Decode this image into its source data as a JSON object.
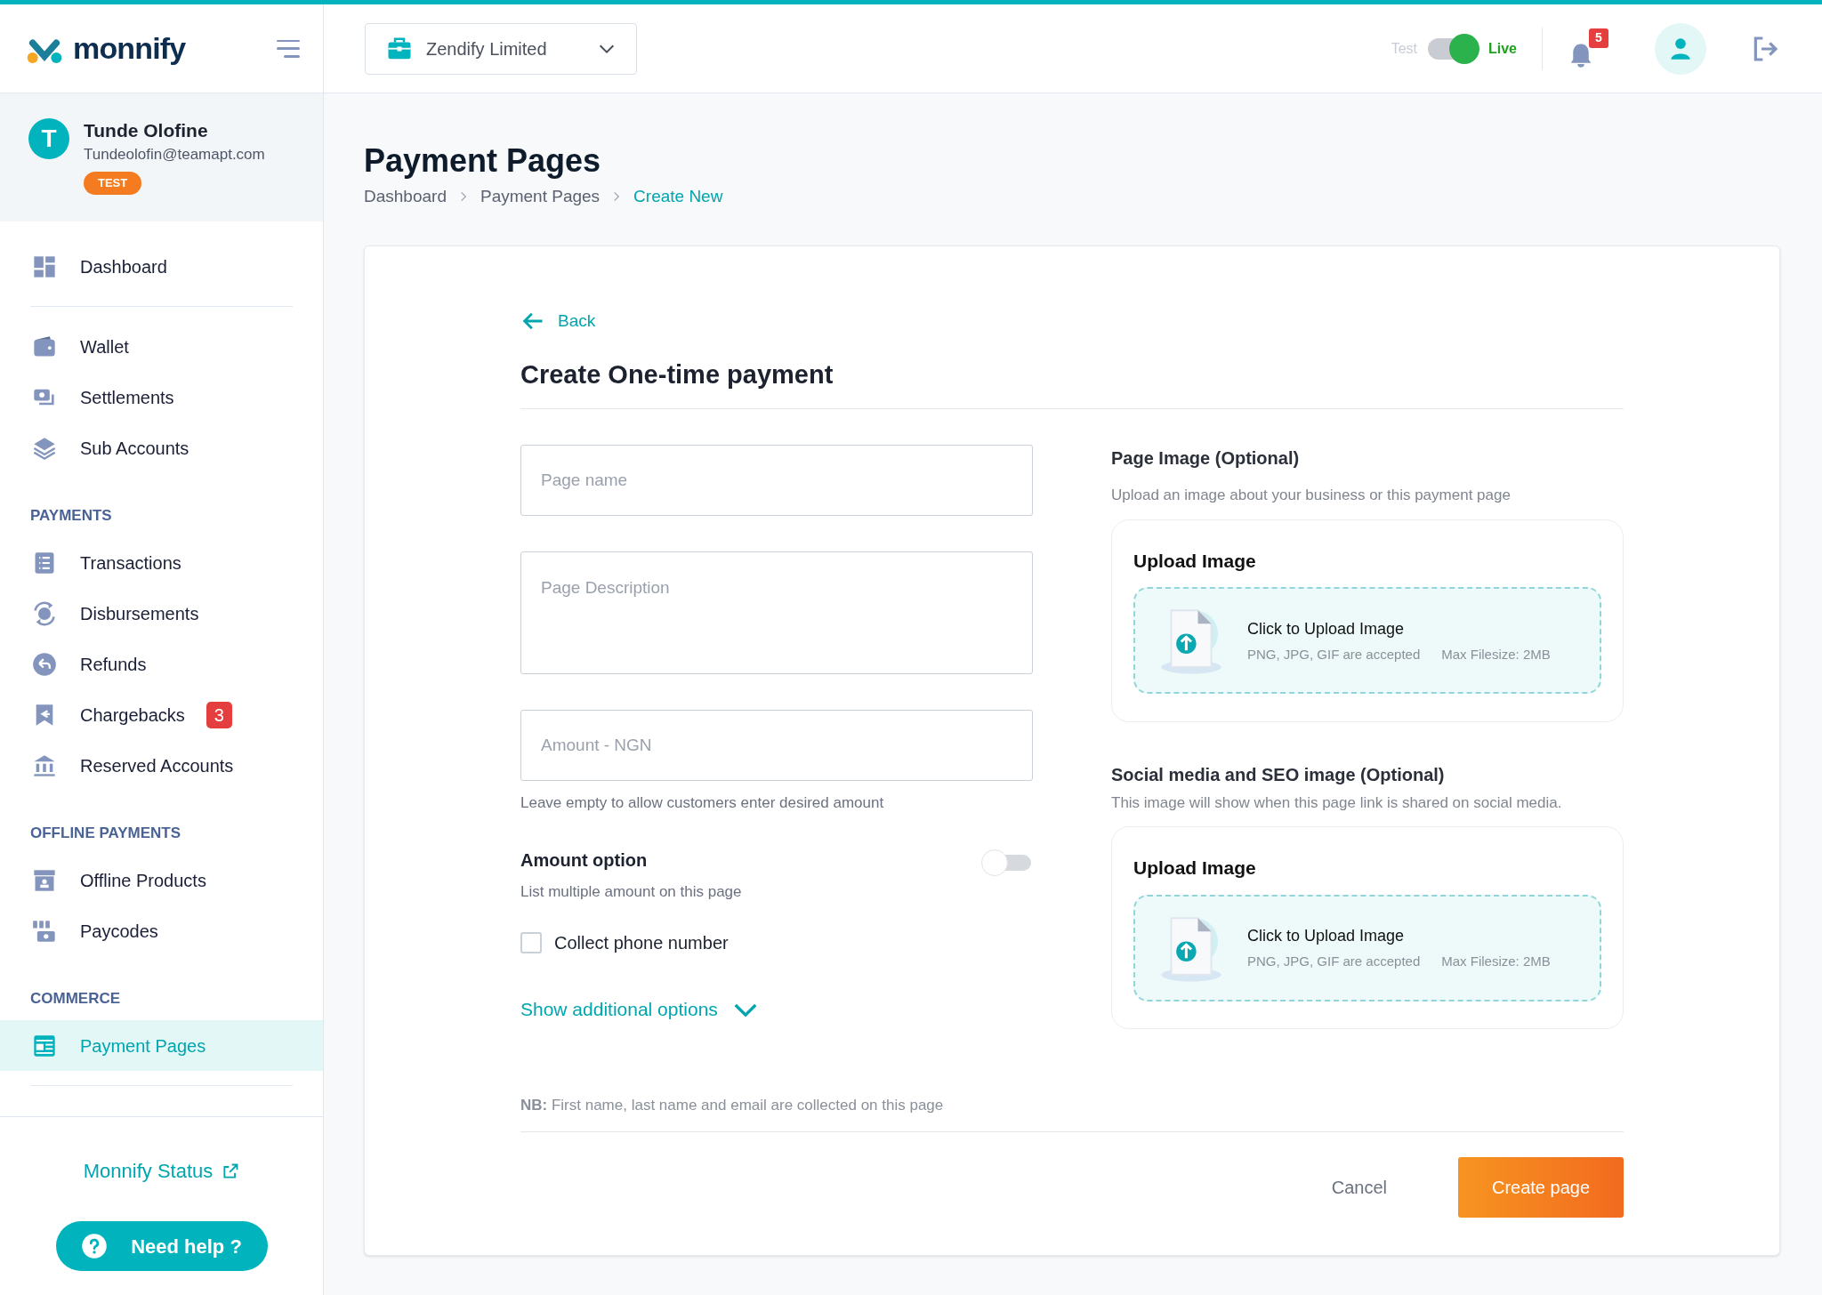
{
  "brand": {
    "name": "monnify"
  },
  "topbar": {
    "business": "Zendify Limited",
    "mode_toggle": {
      "off_label": "Test",
      "on_label": "Live",
      "on": true
    },
    "notification_count": "5"
  },
  "user": {
    "initial": "T",
    "name": "Tunde Olofine",
    "email": "Tundeolofin@teamapt.com",
    "badge": "TEST"
  },
  "sidebar": {
    "sections": [
      {
        "items": [
          {
            "label": "Dashboard",
            "selected": false
          }
        ]
      },
      {
        "items": [
          {
            "label": "Wallet",
            "selected": false
          },
          {
            "label": "Settlements",
            "selected": false
          },
          {
            "label": "Sub Accounts",
            "selected": false
          }
        ]
      },
      {
        "heading": "PAYMENTS",
        "items": [
          {
            "label": "Transactions",
            "selected": false
          },
          {
            "label": "Disbursements",
            "selected": false
          },
          {
            "label": "Refunds",
            "selected": false
          },
          {
            "label": "Chargebacks",
            "selected": false,
            "badge": "3"
          },
          {
            "label": "Reserved Accounts",
            "selected": false
          }
        ]
      },
      {
        "heading": "OFFLINE PAYMENTS",
        "items": [
          {
            "label": "Offline Products",
            "selected": false
          },
          {
            "label": "Paycodes",
            "selected": false
          }
        ]
      },
      {
        "heading": "COMMERCE",
        "items": [
          {
            "label": "Payment Pages",
            "selected": true
          }
        ]
      }
    ],
    "status_link": "Monnify Status",
    "help_button": "Need help ?"
  },
  "page": {
    "title": "Payment Pages",
    "breadcrumbs": [
      {
        "label": "Dashboard",
        "current": false
      },
      {
        "label": "Payment Pages",
        "current": false
      },
      {
        "label": "Create New",
        "current": true
      }
    ]
  },
  "form": {
    "back": "Back",
    "title": "Create One-time payment",
    "fields": [
      {
        "kind": "input",
        "placeholder": "Page name"
      },
      {
        "kind": "textarea",
        "placeholder": "Page Description"
      },
      {
        "kind": "input",
        "placeholder": "Amount - NGN",
        "hint": "Leave empty to allow customers enter desired amount"
      }
    ],
    "amount_option": {
      "title": "Amount option",
      "description": "List multiple amount on this page",
      "on": false
    },
    "collect_phone": {
      "label": "Collect phone number",
      "checked": false
    },
    "more_options": "Show additional options",
    "uploads": [
      {
        "title": "Page Image (Optional)",
        "description": "Upload an image about your business or this payment page",
        "box_title": "Upload Image",
        "action": "Click to Upload Image",
        "formats": "PNG, JPG, GIF are accepted",
        "max_size": "Max Filesize: 2MB"
      },
      {
        "title": "Social media and SEO image (Optional)",
        "description": "This image will show when this page link is shared on social media.",
        "box_title": "Upload Image",
        "action": "Click to Upload Image",
        "formats": "PNG, JPG, GIF are accepted",
        "max_size": "Max Filesize: 2MB"
      }
    ],
    "note": "**NB:** First name, last name and email are collected on this page",
    "cancel": "Cancel",
    "submit": "Create page"
  }
}
